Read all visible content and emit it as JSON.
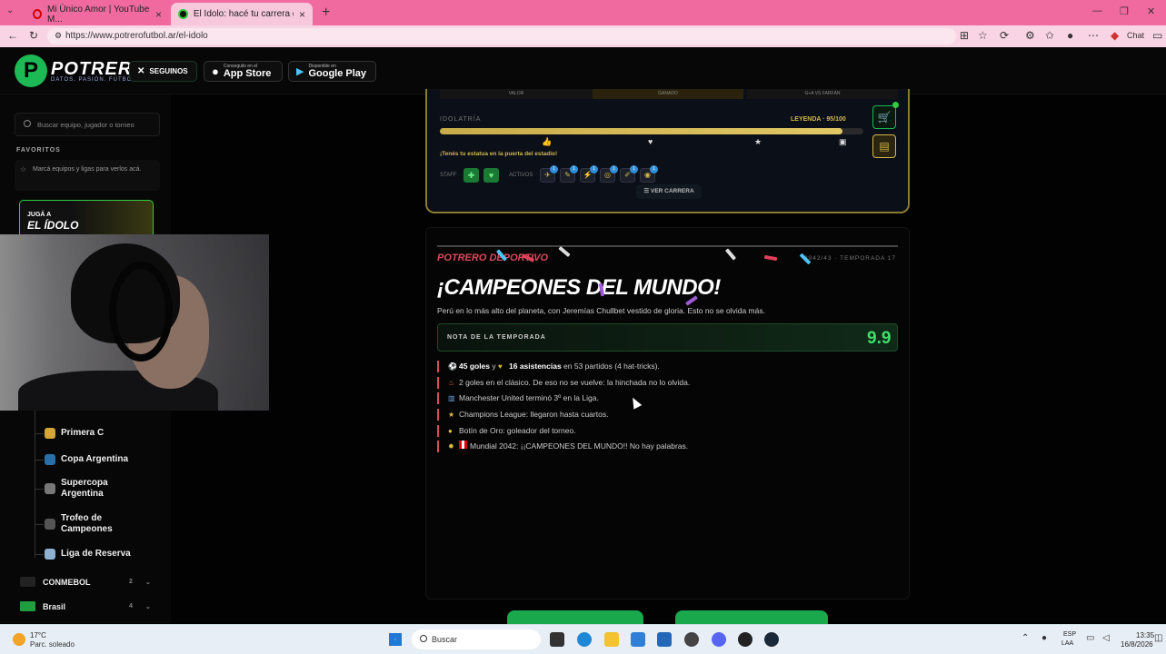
{
  "browser": {
    "tabs": [
      {
        "label": "Mi Único Amor | YouTube M..."
      },
      {
        "label": "El Ídolo: hacé tu carrera de fútbol..."
      }
    ],
    "url": "https://www.potrerofutbol.ar/el-idolo",
    "chat_label": "Chat"
  },
  "header": {
    "brand": "POTRERO",
    "tagline": "DATOS. PASIÓN. FÚTBOL.",
    "follow_label": "SEGUINOS",
    "appstore_small": "Conseguilo en el",
    "appstore_big": "App Store",
    "gplay_small": "Disponible en",
    "gplay_big": "Google Play"
  },
  "sidebar": {
    "search_placeholder": "Buscar equipo, jugador o torneo",
    "favorites_title": "FAVORITOS",
    "favorites_hint": "Marcá equipos y ligas para verlos acá.",
    "promo_line1": "JUGÁ A",
    "promo_line2": "EL ÍDOLO",
    "items": [
      {
        "label": "Primera C"
      },
      {
        "label": "Copa Argentina"
      },
      {
        "label": "Supercopa Argentina"
      },
      {
        "label": "Trofeo de Campeones"
      },
      {
        "label": "Liga de Reserva"
      }
    ],
    "groups": [
      {
        "label": "CONMEBOL",
        "count": "2"
      },
      {
        "label": "Brasil",
        "count": "4"
      }
    ]
  },
  "career": {
    "top_tabs": [
      "VALOR",
      "GANADO",
      "G+A VS FARFÁN"
    ],
    "idol_label": "IDOLATRÍA",
    "idol_value": "LEYENDA · 95/100",
    "idol_progress": 0.95,
    "statue_msg": "¡Tenés tu estatua en la puerta del estadio!",
    "staff_label": "STAFF",
    "actives_label": "ACTIVOS",
    "active_badges": [
      "1",
      "1",
      "1",
      "1",
      "1",
      "1"
    ],
    "btn_career": "VER CARRERA"
  },
  "season": {
    "brand": "POTRERO DEPORTIVO",
    "meta": "2042/43 · TEMPORADA 17",
    "title": "¡CAMPEONES DEL MUNDO!",
    "subtitle": "Perú en lo más alto del planeta, con Jeremías Chullbet vestido de gloria. Esto no se olvida más.",
    "rating_label": "NOTA DE LA TEMPORADA",
    "rating_value": "9.9",
    "facts": [
      {
        "bold1": "45 goles",
        "mid": " y ",
        "bold2": "16 asistencias",
        "rest": " en 53 partidos (4 hat-tricks)."
      },
      {
        "text": "2 goles en el clásico. De eso no se vuelve: la hinchada no lo olvida."
      },
      {
        "text": "Manchester United terminó 3º en la Liga."
      },
      {
        "text": "Champions League: llegaron hasta cuartos."
      },
      {
        "text": "Botín de Oro: goleador del torneo."
      },
      {
        "text": "Mundial 2042: ¡¡CAMPEONES DEL MUNDO!! No hay palabras."
      }
    ]
  },
  "taskbar": {
    "temp": "17°C",
    "weather": "Parc. soleado",
    "search": "Buscar",
    "lang1": "ESP",
    "lang2": "LAA",
    "time": "13:35",
    "date": "16/8/2026"
  }
}
